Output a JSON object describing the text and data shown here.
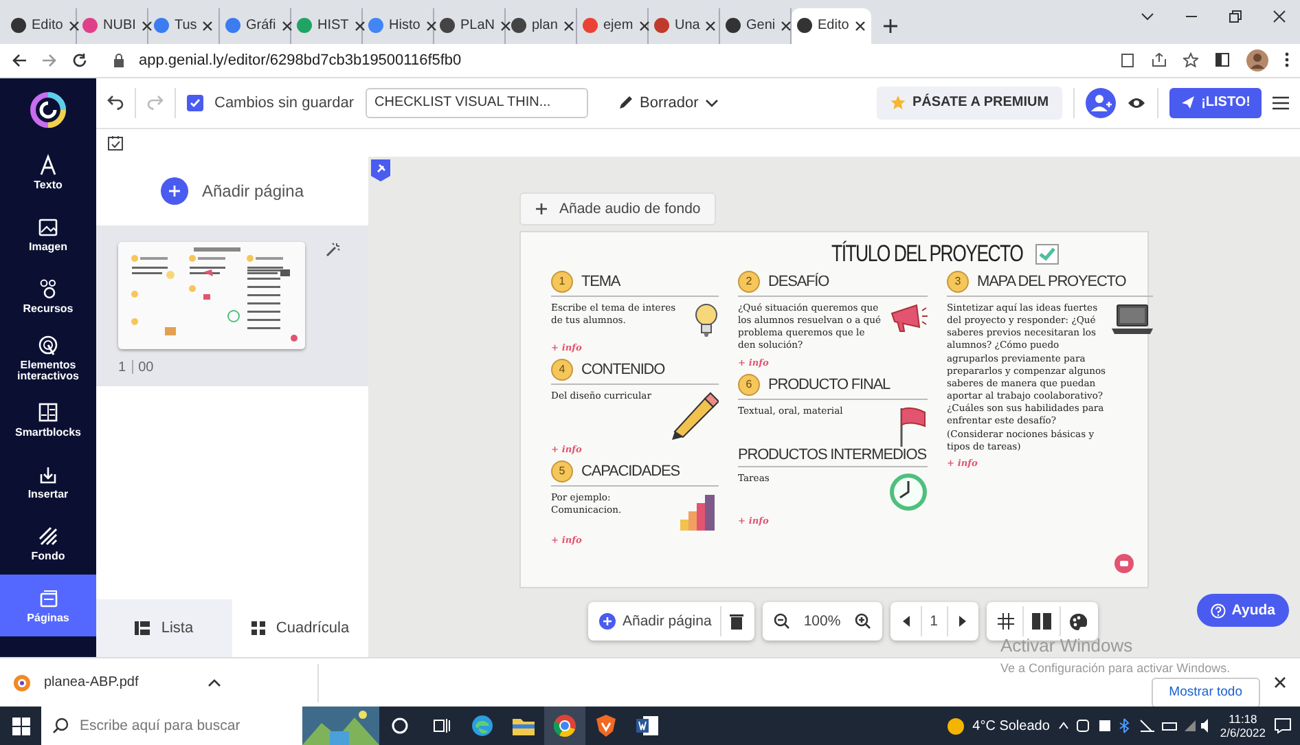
{
  "browser": {
    "tabs": [
      {
        "label": "Edito",
        "selected": false
      },
      {
        "label": "NUBI",
        "selected": false
      },
      {
        "label": "Tus",
        "selected": false
      },
      {
        "label": "Gráfi",
        "selected": false
      },
      {
        "label": "HIST",
        "selected": false
      },
      {
        "label": "Histo",
        "selected": false
      },
      {
        "label": "PLaN",
        "selected": false
      },
      {
        "label": "plan",
        "selected": false
      },
      {
        "label": "ejem",
        "selected": false
      },
      {
        "label": "Una",
        "selected": false
      },
      {
        "label": "Geni",
        "selected": false
      },
      {
        "label": "Edito",
        "selected": true
      }
    ],
    "url": "app.genial.ly/editor/6298bd7cb3b19500116f5fb0"
  },
  "nav": {
    "items": [
      {
        "label": "Texto",
        "selected": false
      },
      {
        "label": "Imagen",
        "selected": false
      },
      {
        "label": "Recursos",
        "selected": false
      },
      {
        "label": "Elementos interactivos",
        "selected": false
      },
      {
        "label": "Smartblocks",
        "selected": false
      },
      {
        "label": "Insertar",
        "selected": false
      },
      {
        "label": "Fondo",
        "selected": false
      },
      {
        "label": "Páginas",
        "selected": true
      }
    ]
  },
  "toolbar": {
    "save_status": {
      "label": "Cambios sin guardar",
      "checked": true
    },
    "title_field": {
      "value": "CHECKLIST VISUAL THIN..."
    },
    "mode": "Borrador",
    "premium": "PÁSATE A PREMIUM",
    "done": "¡LISTO!"
  },
  "pages_panel": {
    "add_page": "Añadir página",
    "pages": [
      {
        "number": "1",
        "label": "00",
        "selected": true
      }
    ],
    "views": [
      {
        "label": "Lista",
        "selected": true
      },
      {
        "label": "Cuadrícula",
        "selected": false
      }
    ]
  },
  "canvas": {
    "audio_button": "Añade audio de fondo",
    "slide": {
      "title": "TÍTULO DEL PROYECTO",
      "columns": [
        [
          {
            "number": "1",
            "heading": "TEMA",
            "body": "Escribe el tema de interes de tus alumnos.",
            "link": "+ info"
          },
          {
            "number": "4",
            "heading": "CONTENIDO",
            "body": "Del diseño curricular",
            "link": "+ info"
          },
          {
            "number": "5",
            "heading": "CAPACIDADES",
            "body": "Por ejemplo: Comunicacion.",
            "link": "+ info"
          }
        ],
        [
          {
            "number": "2",
            "heading": "DESAFÍO",
            "body": "¿Qué situación queremos que los alumnos resuelvan o a qué problema queremos que le den solución?",
            "link": "+ info"
          },
          {
            "number": "6",
            "heading": "PRODUCTO FINAL",
            "body": "Textual, oral, material"
          },
          {
            "heading": "PRODUCTOS INTERMEDIOS",
            "body": "Tareas",
            "link": "+ info"
          }
        ],
        [
          {
            "number": "3",
            "heading": "MAPA DEL PROYECTO",
            "body": "Sintetizar aquí las ideas fuertes del proyecto y responder: ¿Qué saberes previos necesitaran los alumnos? ¿Cómo puedo agruparlos previamente para prepararlos y compenzar algunos saberes de manera que puedan aportar al trabajo coolaborativo? ¿Cuáles son sus habilidades para enfrentar este desafío? (Considerar nociones básicas y tipos de tareas)",
            "link": "+ info"
          }
        ]
      ]
    }
  },
  "bottom_toolbar": {
    "add_page": "Añadir página",
    "zoom": "100%",
    "page": "1"
  },
  "help_button": "Ayuda",
  "windows_notice": {
    "title": "Activar Windows",
    "text": "Ve a Configuración para activar Windows."
  },
  "downloads": {
    "file": "planea-ABP.pdf",
    "show_all": "Mostrar todo"
  },
  "taskbar": {
    "search_placeholder": "Escribe aquí para buscar",
    "weather": "4°C Soleado",
    "time": "11:18",
    "date": "2/6/2022"
  }
}
